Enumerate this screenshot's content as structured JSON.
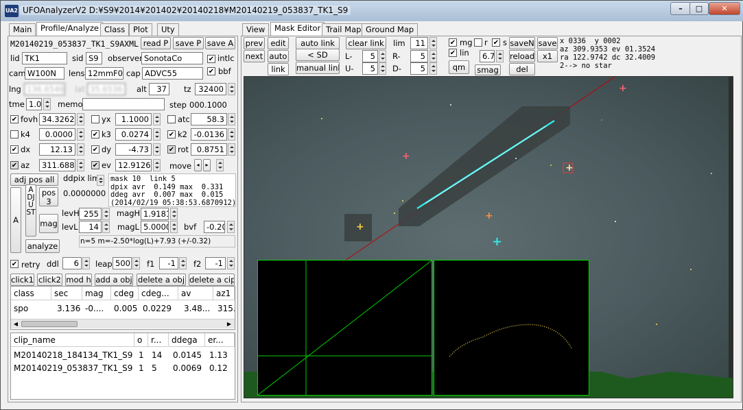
{
  "window": {
    "title": "UFOAnalyzerV2 D:¥S9¥2014¥201402¥20140218¥M20140219_053837_TK1_S9",
    "icon_text": "UA2"
  },
  "left_tabs": [
    "Main",
    "Profile/Analyze",
    "Class",
    "Plot",
    "Uty"
  ],
  "right_tabs": [
    "View",
    "Mask Editor",
    "Trail Map",
    "Ground Map"
  ],
  "left": {
    "filename": "M20140219_053837_TK1_S9AXML",
    "read_p": "read P",
    "save_p": "save P",
    "save_a": "save A",
    "lid_label": "lid",
    "lid": "TK1",
    "sid_label": "sid",
    "sid": "S9",
    "observer_label": "observer",
    "observer": "SonotaCo",
    "intlc": "intlc",
    "cam_label": "cam",
    "cam": "W100N",
    "lens_label": "lens",
    "lens": "12mmF0.8",
    "cap_label": "cap",
    "cap": "ADVC55",
    "bbf": "bbf",
    "lng_label": "lng",
    "lng": "136.6546",
    "lat_label": "lat",
    "lat": "35.6536",
    "alt_label": "alt",
    "alt": "37",
    "tz_label": "tz",
    "tz": "32400",
    "tme_label": "tme",
    "tme": "1.0",
    "memo_label": "memo",
    "memo": "",
    "step_label": "step",
    "step": "000.1000",
    "fovh_label": "fovh",
    "fovh": "34.3262",
    "yx_label": "yx",
    "yx": "1.1000",
    "atc_label": "atc",
    "atc": "58.3",
    "k4_label": "k4",
    "k4": "0.0000",
    "k3_label": "k3",
    "k3": "0.0274",
    "k2_label": "k2",
    "k2": "-0.0136",
    "dx_label": "dx",
    "dx": "12.13",
    "dy_label": "dy",
    "dy": "-4.73",
    "rot_label": "rot",
    "rot": "0.8751",
    "az_label": "az",
    "az": "311.6884",
    "ev_label": "ev",
    "ev": "12.9126",
    "move_label": "move",
    "adj_pos_all": "adj pos all",
    "ddpix_label": "ddpix lim",
    "ddpix": "0.0000000",
    "mask_info": [
      "mask 10  link 5",
      "dpix avr  0.149 max  0.331",
      "ddeg avr  0.007 max  0.015",
      "(2014/02/19 05:38:53.6870912)"
    ],
    "a_btn": "A",
    "adjust": "ADJUST",
    "pos_btn": "pos 3",
    "mag_btn": "mag",
    "analyze_btn": "analyze",
    "levH_label": "levH",
    "levH": "255",
    "magH_label": "magH",
    "magH": "1.9181",
    "levL_label": "levL",
    "levL": "14",
    "magL_label": "magL",
    "magL": "5.0000",
    "bvf_label": "bvf",
    "bvf": "-0.20",
    "formula": "n=5 m=-2.50*log(L)+7.93 (+/-0.32)",
    "retry": "retry",
    "ddl_label": "ddl",
    "ddl": "6",
    "leap_label": "leap",
    "leap": "500",
    "f1_label": "f1",
    "f1": "-1",
    "f2_label": "f2",
    "f2": "-1",
    "click1": "click1",
    "click2": "click2",
    "mod_h": "mod h",
    "add_obj": "add a obj",
    "delete_obj": "delete a obj",
    "delete_cip": "delete a cip"
  },
  "class_table": {
    "headers": [
      "class",
      "sec",
      "mag",
      "cdeg",
      "cdeg...",
      "av",
      "az1"
    ],
    "rows": [
      [
        "spo",
        "3.136",
        "-0....",
        "0.005",
        "0.0229",
        "3.48...",
        "315..."
      ]
    ]
  },
  "clip_table": {
    "headers": [
      "clip_name",
      "o",
      "r...",
      "ddega",
      "er..."
    ],
    "rows": [
      [
        "M20140218_184134_TK1_S9",
        "1",
        "14",
        "0.0145",
        "1.13"
      ],
      [
        "M20140219_053837_TK1_S9",
        "1",
        "5",
        "0.0069",
        "0.12"
      ]
    ]
  },
  "mask": {
    "prev": "prev",
    "edit": "edit",
    "auto_link": "auto link",
    "clear_link": "clear link",
    "lim_label": "lim",
    "lim": "11",
    "next": "next",
    "auto": "auto",
    "sd": "< SD",
    "l_minus": "L-",
    "l_minus_val": "5",
    "r_minus": "R-",
    "r_minus_val": "5",
    "link": "link",
    "manual_link": "manual link",
    "u_minus": "U-",
    "u_minus_val": "5",
    "d_minus": "D-",
    "d_minus_val": "5",
    "mg": "mg",
    "r": "r",
    "s": "s",
    "saveN": "saveN",
    "save": "save",
    "lin": "lin",
    "lin_val": "6.7",
    "reload": "reload",
    "x1": "x1",
    "qm": "qm",
    "smag": "smag",
    "del": "del",
    "readout": [
      "x 0336  y 0002",
      "az 309.9353 ev 01.3524",
      "ra 122.9742 dc 32.4009",
      "2--> no star"
    ]
  },
  "colors": {
    "trail": "#33e6e6",
    "green": "#00d000",
    "red": "#c00000"
  }
}
